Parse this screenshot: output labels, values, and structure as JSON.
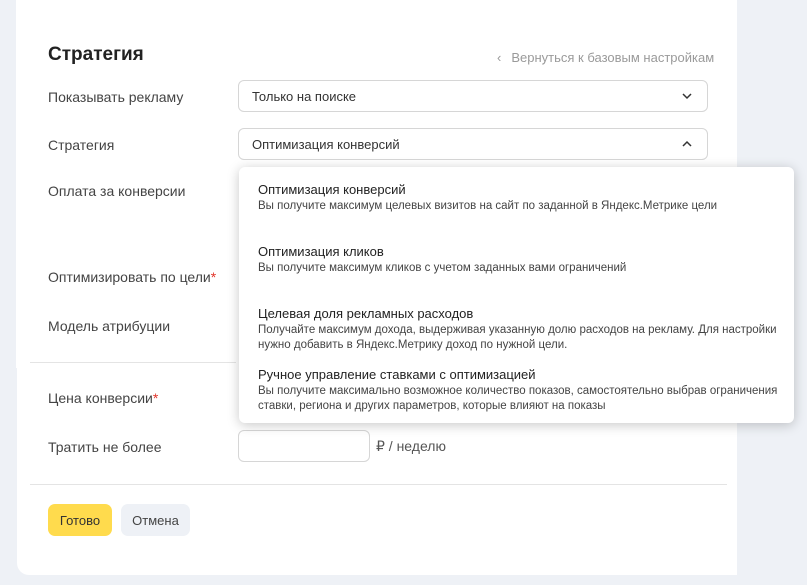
{
  "title": "Стратегия",
  "back_link": "Вернуться к базовым настройкам",
  "fields": {
    "show_ads": {
      "label": "Показывать рекламу",
      "value": "Только на поиске"
    },
    "strategy": {
      "label": "Стратегия",
      "value": "Оптимизация конверсий"
    },
    "pay_per_conversion": {
      "label": "Оплата за конверсии"
    },
    "optimize_goal": {
      "label": "Оптимизировать по цели",
      "required_mark": "*"
    },
    "attribution": {
      "label": "Модель атрибуции"
    },
    "conversion_price": {
      "label": "Цена конверсии",
      "required_mark": "*"
    },
    "spend_limit": {
      "label": "Тратить не более",
      "value": "",
      "unit": "₽ / неделю"
    }
  },
  "buttons": {
    "done": "Готово",
    "cancel": "Отмена"
  },
  "strategy_dropdown": {
    "options": [
      {
        "title": "Оптимизация конверсий",
        "description": "Вы получите максимум целевых визитов на сайт по заданной в Яндекс.Метрике цели"
      },
      {
        "title": "Оптимизация кликов",
        "description": "Вы получите максимум кликов с учетом заданных вами ограничений"
      },
      {
        "title": "Целевая доля рекламных расходов",
        "description": "Получайте максимум дохода, выдерживая указанную долю расходов на рекламу. Для настройки нужно добавить в Яндекс.Метрику доход по нужной цели."
      },
      {
        "title": "Ручное управление ставками с оптимизацией",
        "description": "Вы получите максимально возможное количество показов, самостоятельно выбрав ограничения ставки, региона и других параметров, которые влияют на показы"
      }
    ]
  },
  "colors": {
    "primary_button": "#ffdb4d",
    "secondary_button": "#eef1f6",
    "required": "#e2352a"
  }
}
